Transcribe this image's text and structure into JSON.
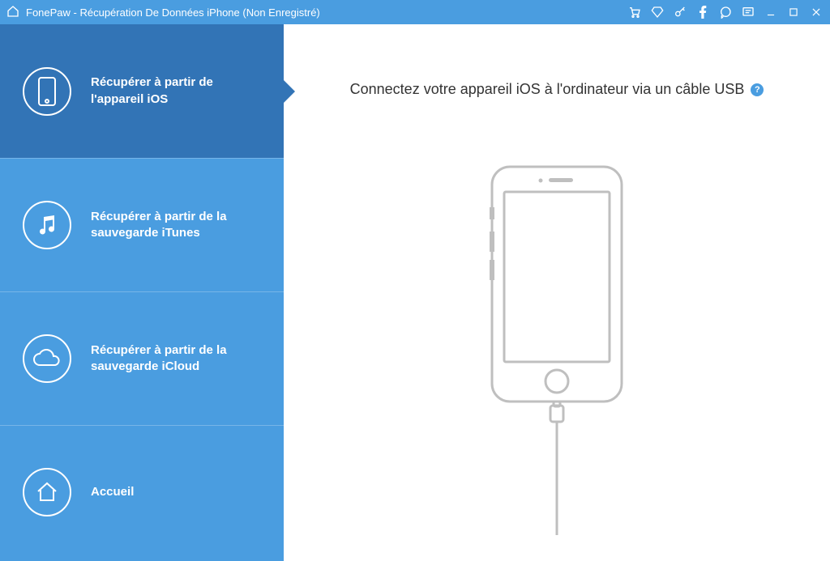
{
  "app": {
    "title": "FonePaw - Récupération De Données iPhone (Non Enregistré)"
  },
  "titlebar_icons": {
    "cart": "cart-icon",
    "diamond": "diamond-icon",
    "key": "key-icon",
    "facebook": "facebook-icon",
    "chat": "chat-icon",
    "feedback": "feedback-icon",
    "minimize": "minimize-icon",
    "maximize": "maximize-icon",
    "close": "close-icon"
  },
  "sidebar": {
    "items": [
      {
        "label": "Récupérer à partir de l'appareil iOS",
        "icon": "phone-icon",
        "active": true
      },
      {
        "label": "Récupérer à partir de la sauvegarde iTunes",
        "icon": "music-icon",
        "active": false
      },
      {
        "label": "Récupérer à partir de la sauvegarde iCloud",
        "icon": "cloud-icon",
        "active": false
      },
      {
        "label": "Accueil",
        "icon": "home-icon",
        "active": false
      }
    ]
  },
  "main": {
    "heading": "Connectez votre appareil iOS à l'ordinateur via un câble USB",
    "help": "?"
  }
}
